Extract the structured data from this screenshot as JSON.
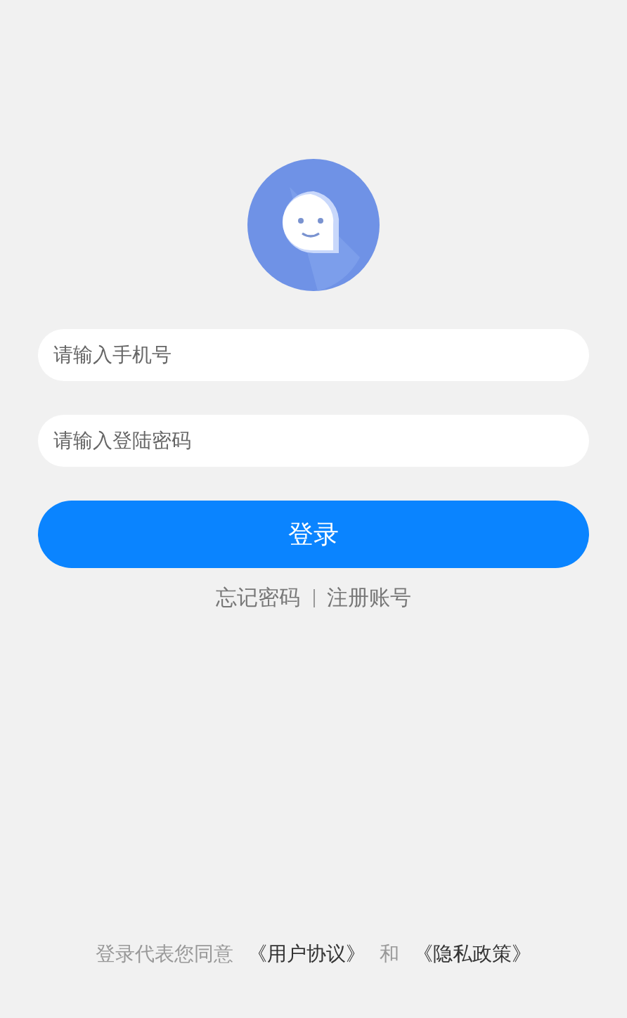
{
  "fields": [
    {
      "placeholder": "请输入手机号"
    },
    {
      "placeholder": "请输入登陆密码"
    }
  ],
  "login_button": "登录",
  "links": [
    "忘记密码",
    "注册账号"
  ],
  "footer": {
    "text": "登录代表您同意",
    "agreements": [
      "《用户协议》",
      "《隐私政策》"
    ],
    "joiner": "和"
  }
}
